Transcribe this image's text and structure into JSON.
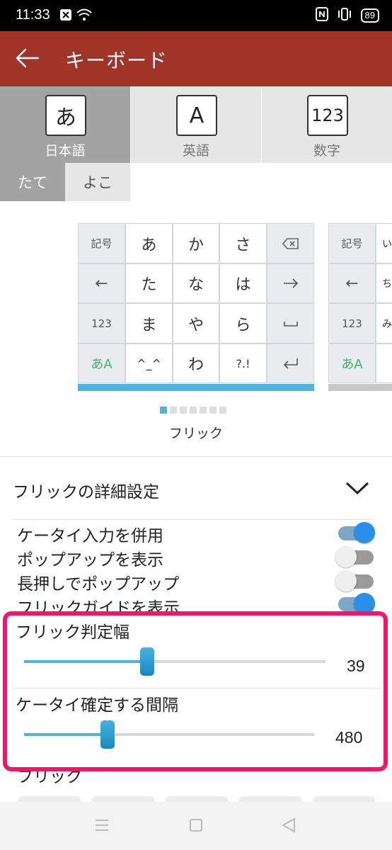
{
  "status_bar": {
    "time": "11:33",
    "battery": "89"
  },
  "app_bar": {
    "title": "キーボード"
  },
  "keyboard_tabs": [
    {
      "glyph": "あ",
      "label": "日本語",
      "selected": true
    },
    {
      "glyph": "A",
      "label": "英語",
      "selected": false
    },
    {
      "glyph": "123",
      "label": "数字",
      "selected": false
    }
  ],
  "orientation_tabs": [
    {
      "label": "たて",
      "selected": true
    },
    {
      "label": "よこ",
      "selected": false
    }
  ],
  "keyboard_preview": {
    "side_left": [
      "記号",
      "←",
      "123",
      "あA"
    ],
    "keys": [
      "あ",
      "か",
      "さ",
      "た",
      "な",
      "は",
      "ま",
      "や",
      "ら",
      "^_^",
      "わ",
      "?.!"
    ],
    "side_right_icons": [
      "backspace-icon",
      "arrow-right-icon",
      "space-icon",
      "enter-icon"
    ],
    "second_preview_side": [
      "記号",
      "←",
      "123",
      "あA"
    ],
    "second_preview_keys": [
      "い",
      "ち",
      "み"
    ],
    "page_count": 7,
    "current_page": 1,
    "mode_label": "フリック"
  },
  "flick_settings": {
    "header": "フリックの詳細設定",
    "toggles": [
      {
        "label": "ケータイ入力を併用",
        "on": true
      },
      {
        "label": "ポップアップを表示",
        "on": false
      },
      {
        "label": "長押しでポップアップ",
        "on": false
      },
      {
        "label": "フリックガイドを表示",
        "on": true
      }
    ],
    "sliders": [
      {
        "label": "フリック判定幅",
        "value": "39",
        "fraction": 0.4
      },
      {
        "label": "ケータイ確定する間隔",
        "value": "480",
        "fraction": 0.29
      }
    ],
    "cut_off_label": "フリック"
  },
  "colors": {
    "app_bar": "#a13428",
    "accent": "#4fb3e0",
    "highlight": "#f2166a"
  }
}
